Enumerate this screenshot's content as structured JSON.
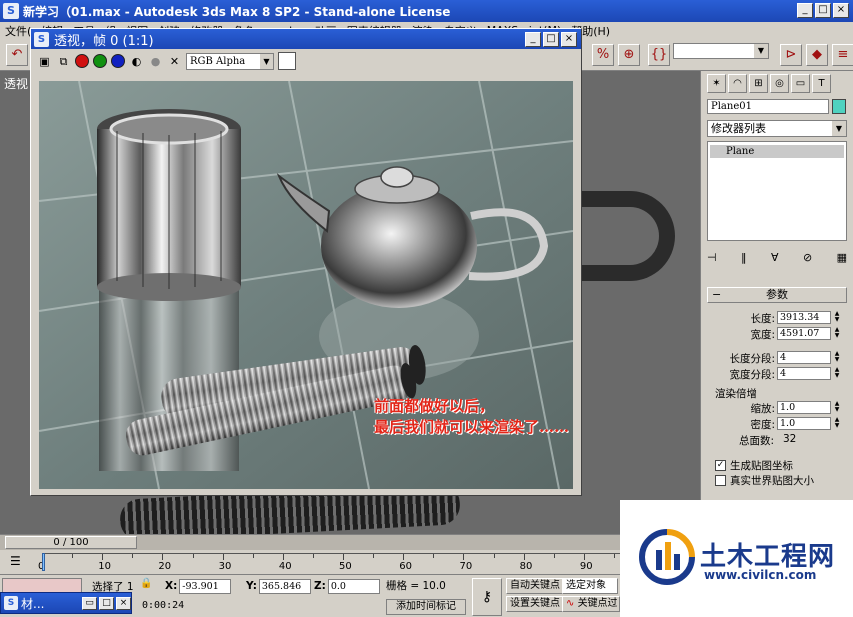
{
  "window": {
    "title": "新学习（01.max - Autodesk 3ds Max 8 SP2 - Stand-alone License",
    "app_icon": "3ds-max-icon"
  },
  "menu": {
    "items": [
      "文件(",
      "编辑",
      "工具",
      "组",
      "视图",
      "创建",
      "修改器",
      "角色",
      "reactor",
      "动画",
      "图表编辑器",
      "渲染",
      "自定义",
      "MAXScript(M)",
      "帮助(H)"
    ]
  },
  "toolbar": {
    "combo_value": ""
  },
  "viewport": {
    "label": "透视"
  },
  "render_window": {
    "title": "透视，帧 0 (1:1)",
    "channel_select": "RGB Alpha",
    "channel_colors": {
      "red": "#d01010",
      "green": "#109010",
      "blue": "#1020c0"
    },
    "caption_line1": "前面都做好以后，",
    "caption_line2": "最后我们就可以来渲染了……"
  },
  "command_panel": {
    "object_name": "Plane01",
    "object_color": "#4fd2c0",
    "modifier_list": "修改器列表",
    "stack_item": "Plane",
    "rollout_title": "参数",
    "params": {
      "length_label": "长度:",
      "length_value": "3913.34",
      "width_label": "宽度:",
      "width_value": "4591.07",
      "length_segs_label": "长度分段:",
      "length_segs_value": "4",
      "width_segs_label": "宽度分段:",
      "width_segs_value": "4",
      "render_mult_label": "渲染倍增",
      "scale_label": "缩放:",
      "scale_value": "1.0",
      "density_label": "密度:",
      "density_value": "1.0",
      "total_faces_label": "总面数:",
      "total_faces_value": "32",
      "gen_map_coords": "生成贴图坐标",
      "real_world_map": "真实世界贴图大小"
    }
  },
  "timeline": {
    "frame_display": "0 / 100",
    "ticks": [
      "0",
      "10",
      "20",
      "30",
      "40",
      "50",
      "60",
      "70",
      "80",
      "90"
    ]
  },
  "status": {
    "selected": "选择了 1",
    "x_label": "X:",
    "x_value": "-93.901",
    "y_label": "Y:",
    "y_value": "365.846",
    "z_label": "Z:",
    "z_value": "0.0",
    "grid": "栅格 = 10.0",
    "auto_key": "自动关键点",
    "selected_obj": "选定对象",
    "set_key": "设置关键点",
    "key_filter": "关键点过",
    "time": "0:00:24",
    "add_time_tag": "添加时间标记"
  },
  "minimized_window": {
    "title": "材..."
  },
  "watermark": {
    "text": "土木工程网",
    "url": "www.civilcn.com"
  }
}
